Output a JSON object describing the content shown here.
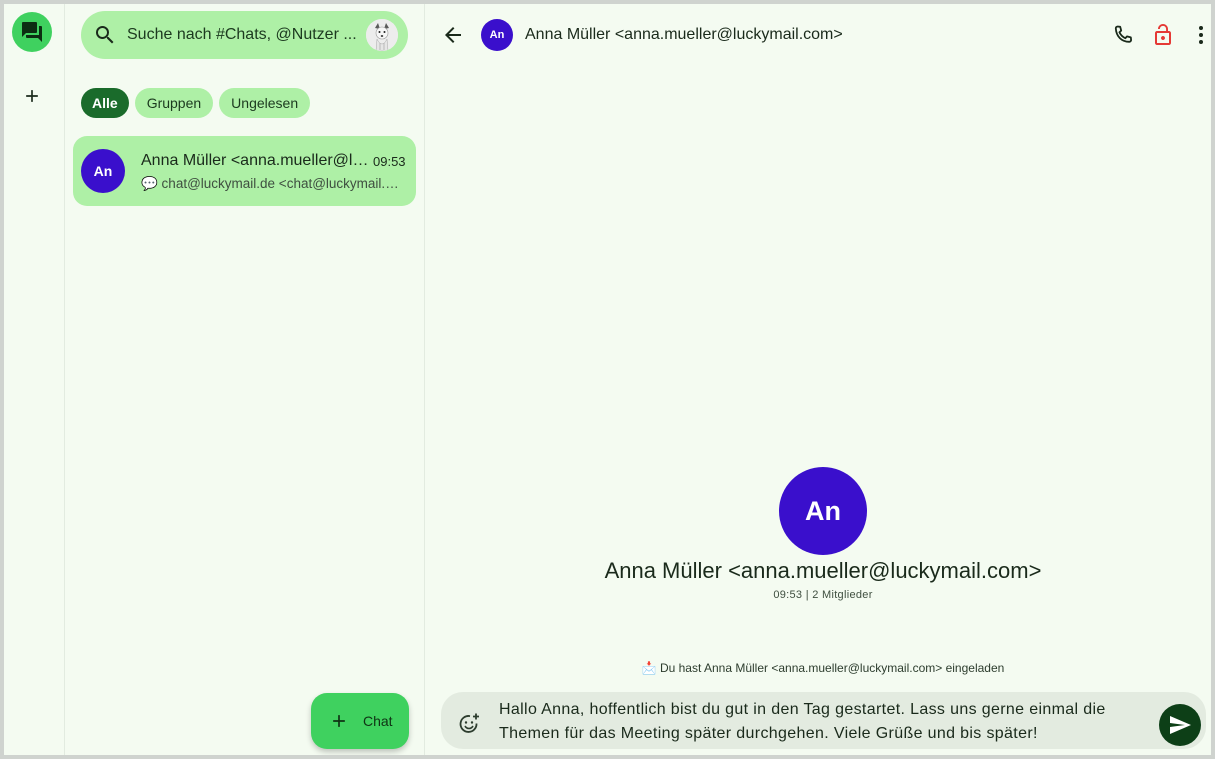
{
  "rail": {
    "chats_icon": "chat-bubbles-icon",
    "add_icon": "plus-icon"
  },
  "search": {
    "placeholder": "Suche nach #Chats, @Nutzer ...",
    "icon": "search-icon"
  },
  "filters": [
    {
      "label": "Alle",
      "active": true
    },
    {
      "label": "Gruppen",
      "active": false
    },
    {
      "label": "Ungelesen",
      "active": false
    }
  ],
  "chat_list": [
    {
      "avatar_initials": "An",
      "name": "Anna Müller <anna.mueller@luckymail.com>",
      "time": "09:53",
      "preview": "💬 chat@luckymail.de <chat@luckymail.de> hat Anna Müller eingeladen"
    }
  ],
  "fab": {
    "label": "Chat",
    "icon": "plus-icon"
  },
  "conversation": {
    "title": "Anna Müller <anna.mueller@luckymail.com>",
    "avatar_initials": "An",
    "meta": "09:53 | 2 Mitglieder",
    "system_message": "📩 Du hast Anna Müller <anna.mueller@luckymail.com> eingeladen",
    "composer_text": "Hallo Anna, hoffentlich bist du gut in den Tag gestartet. Lass uns gerne einmal die Themen für das Meeting später durchgehen. Viele Grüße und bis später!"
  },
  "colors": {
    "accent": "#3fd15f",
    "chip_bg": "#aef0a6",
    "chip_active": "#1a6b2b",
    "avatar": "#3a0fcc",
    "lock_icon": "#e53935",
    "background": "#f4fbf1"
  }
}
